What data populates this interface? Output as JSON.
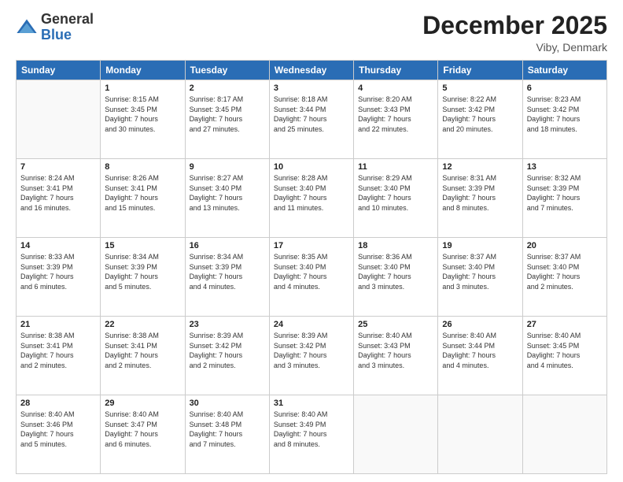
{
  "header": {
    "logo": {
      "general": "General",
      "blue": "Blue"
    },
    "title": "December 2025",
    "location": "Viby, Denmark"
  },
  "calendar": {
    "days_of_week": [
      "Sunday",
      "Monday",
      "Tuesday",
      "Wednesday",
      "Thursday",
      "Friday",
      "Saturday"
    ],
    "weeks": [
      [
        {
          "day": "",
          "info": ""
        },
        {
          "day": "1",
          "info": "Sunrise: 8:15 AM\nSunset: 3:45 PM\nDaylight: 7 hours\nand 30 minutes."
        },
        {
          "day": "2",
          "info": "Sunrise: 8:17 AM\nSunset: 3:45 PM\nDaylight: 7 hours\nand 27 minutes."
        },
        {
          "day": "3",
          "info": "Sunrise: 8:18 AM\nSunset: 3:44 PM\nDaylight: 7 hours\nand 25 minutes."
        },
        {
          "day": "4",
          "info": "Sunrise: 8:20 AM\nSunset: 3:43 PM\nDaylight: 7 hours\nand 22 minutes."
        },
        {
          "day": "5",
          "info": "Sunrise: 8:22 AM\nSunset: 3:42 PM\nDaylight: 7 hours\nand 20 minutes."
        },
        {
          "day": "6",
          "info": "Sunrise: 8:23 AM\nSunset: 3:42 PM\nDaylight: 7 hours\nand 18 minutes."
        }
      ],
      [
        {
          "day": "7",
          "info": "Sunrise: 8:24 AM\nSunset: 3:41 PM\nDaylight: 7 hours\nand 16 minutes."
        },
        {
          "day": "8",
          "info": "Sunrise: 8:26 AM\nSunset: 3:41 PM\nDaylight: 7 hours\nand 15 minutes."
        },
        {
          "day": "9",
          "info": "Sunrise: 8:27 AM\nSunset: 3:40 PM\nDaylight: 7 hours\nand 13 minutes."
        },
        {
          "day": "10",
          "info": "Sunrise: 8:28 AM\nSunset: 3:40 PM\nDaylight: 7 hours\nand 11 minutes."
        },
        {
          "day": "11",
          "info": "Sunrise: 8:29 AM\nSunset: 3:40 PM\nDaylight: 7 hours\nand 10 minutes."
        },
        {
          "day": "12",
          "info": "Sunrise: 8:31 AM\nSunset: 3:39 PM\nDaylight: 7 hours\nand 8 minutes."
        },
        {
          "day": "13",
          "info": "Sunrise: 8:32 AM\nSunset: 3:39 PM\nDaylight: 7 hours\nand 7 minutes."
        }
      ],
      [
        {
          "day": "14",
          "info": "Sunrise: 8:33 AM\nSunset: 3:39 PM\nDaylight: 7 hours\nand 6 minutes."
        },
        {
          "day": "15",
          "info": "Sunrise: 8:34 AM\nSunset: 3:39 PM\nDaylight: 7 hours\nand 5 minutes."
        },
        {
          "day": "16",
          "info": "Sunrise: 8:34 AM\nSunset: 3:39 PM\nDaylight: 7 hours\nand 4 minutes."
        },
        {
          "day": "17",
          "info": "Sunrise: 8:35 AM\nSunset: 3:40 PM\nDaylight: 7 hours\nand 4 minutes."
        },
        {
          "day": "18",
          "info": "Sunrise: 8:36 AM\nSunset: 3:40 PM\nDaylight: 7 hours\nand 3 minutes."
        },
        {
          "day": "19",
          "info": "Sunrise: 8:37 AM\nSunset: 3:40 PM\nDaylight: 7 hours\nand 3 minutes."
        },
        {
          "day": "20",
          "info": "Sunrise: 8:37 AM\nSunset: 3:40 PM\nDaylight: 7 hours\nand 2 minutes."
        }
      ],
      [
        {
          "day": "21",
          "info": "Sunrise: 8:38 AM\nSunset: 3:41 PM\nDaylight: 7 hours\nand 2 minutes."
        },
        {
          "day": "22",
          "info": "Sunrise: 8:38 AM\nSunset: 3:41 PM\nDaylight: 7 hours\nand 2 minutes."
        },
        {
          "day": "23",
          "info": "Sunrise: 8:39 AM\nSunset: 3:42 PM\nDaylight: 7 hours\nand 2 minutes."
        },
        {
          "day": "24",
          "info": "Sunrise: 8:39 AM\nSunset: 3:42 PM\nDaylight: 7 hours\nand 3 minutes."
        },
        {
          "day": "25",
          "info": "Sunrise: 8:40 AM\nSunset: 3:43 PM\nDaylight: 7 hours\nand 3 minutes."
        },
        {
          "day": "26",
          "info": "Sunrise: 8:40 AM\nSunset: 3:44 PM\nDaylight: 7 hours\nand 4 minutes."
        },
        {
          "day": "27",
          "info": "Sunrise: 8:40 AM\nSunset: 3:45 PM\nDaylight: 7 hours\nand 4 minutes."
        }
      ],
      [
        {
          "day": "28",
          "info": "Sunrise: 8:40 AM\nSunset: 3:46 PM\nDaylight: 7 hours\nand 5 minutes."
        },
        {
          "day": "29",
          "info": "Sunrise: 8:40 AM\nSunset: 3:47 PM\nDaylight: 7 hours\nand 6 minutes."
        },
        {
          "day": "30",
          "info": "Sunrise: 8:40 AM\nSunset: 3:48 PM\nDaylight: 7 hours\nand 7 minutes."
        },
        {
          "day": "31",
          "info": "Sunrise: 8:40 AM\nSunset: 3:49 PM\nDaylight: 7 hours\nand 8 minutes."
        },
        {
          "day": "",
          "info": ""
        },
        {
          "day": "",
          "info": ""
        },
        {
          "day": "",
          "info": ""
        }
      ]
    ]
  }
}
